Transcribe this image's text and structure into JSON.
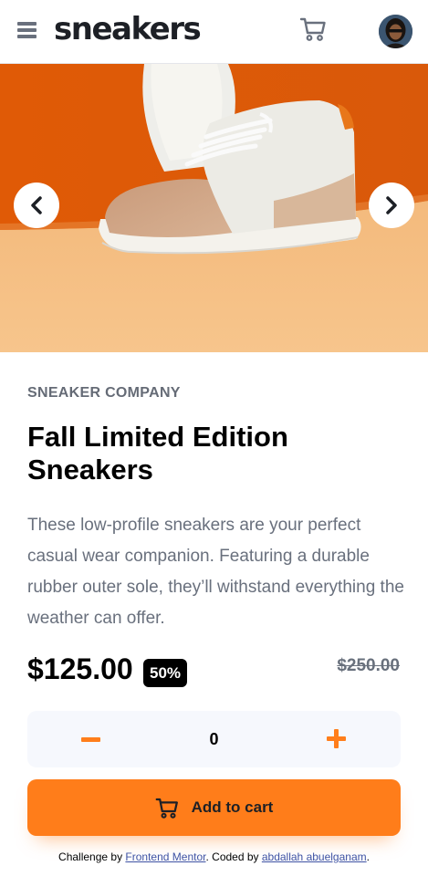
{
  "header": {
    "logo": "sneakers",
    "menu_icon": "hamburger-menu-icon",
    "cart_icon": "cart-icon",
    "avatar_icon": "user-avatar"
  },
  "gallery": {
    "prev_icon": "chevron-left-icon",
    "next_icon": "chevron-right-icon"
  },
  "product": {
    "company": "Sneaker Company",
    "title": "Fall Limited Edition Sneakers",
    "description": "These low-profile sneakers are your perfect casual wear companion. Featuring a durable rubber outer sole, they’ll withstand everything the weather can offer.",
    "price": "$125.00",
    "discount": "50%",
    "original_price": "$250.00"
  },
  "quantity": {
    "value": "0",
    "minus_icon": "minus-icon",
    "plus_icon": "plus-icon"
  },
  "add_to_cart": {
    "label": "Add to cart",
    "icon": "cart-icon"
  },
  "attribution": {
    "prefix": "Challenge by ",
    "link1": "Frontend Mentor",
    "middle": ". Coded by ",
    "link2": "abdallah abuelganam",
    "suffix": "."
  },
  "colors": {
    "accent": "#ff7d1a",
    "dark": "#1d2026",
    "muted": "#69707d",
    "quantity_bg": "#f6f8fd"
  }
}
